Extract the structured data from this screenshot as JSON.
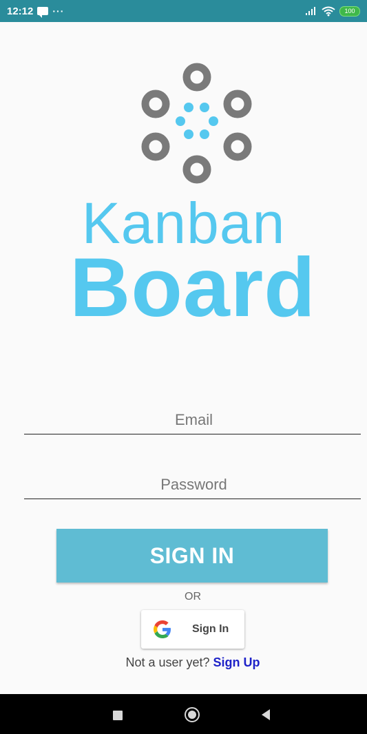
{
  "status_bar": {
    "time": "12:12",
    "more_dots": "···",
    "battery": "100",
    "icons": [
      "message-icon",
      "signal-icon",
      "wifi-icon",
      "battery-icon"
    ]
  },
  "logo": {
    "line1": "Kanban",
    "line2": "Board",
    "colors": {
      "brand_blue": "#55c8ef",
      "ring_gray": "#7a7a7a"
    }
  },
  "form": {
    "email_placeholder": "Email",
    "password_placeholder": "Password",
    "signin_label": "SIGN IN",
    "or_label": "OR",
    "google_label": "Sign In",
    "signup_prompt": "Not a user yet?",
    "signup_link": "Sign Up",
    "colors": {
      "signin_bg": "#5fbcd3",
      "link": "#1e22c8"
    }
  },
  "nav_bar": {
    "icons": [
      "recents-icon",
      "home-icon",
      "back-icon"
    ]
  }
}
